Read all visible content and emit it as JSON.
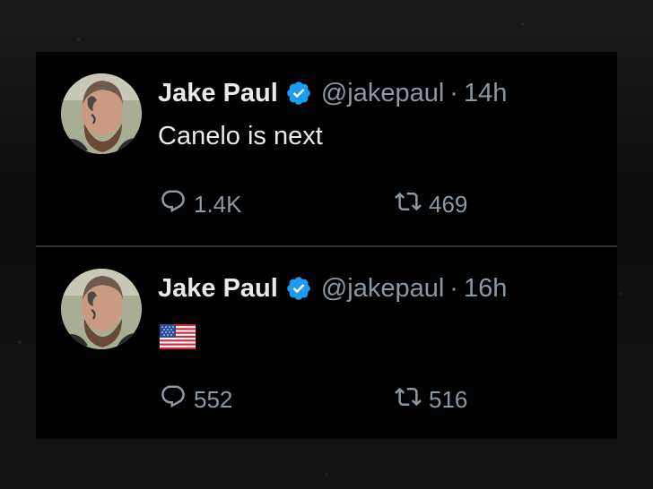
{
  "tweets": [
    {
      "author": "Jake Paul",
      "handle": "@jakepaul",
      "separator": "·",
      "time": "14h",
      "text": "Canelo is next",
      "replies": "1.4K",
      "retweets": "469"
    },
    {
      "author": "Jake Paul",
      "handle": "@jakepaul",
      "separator": "·",
      "time": "16h",
      "text_icon": "us-flag-emoji",
      "replies": "552",
      "retweets": "516"
    }
  ],
  "colors": {
    "background": "#000000",
    "primary_text": "#e7e9ea",
    "secondary_text": "#8b98a5",
    "verified": "#1d9bf0",
    "divider": "#2f3336"
  },
  "icons": {
    "verified": "verified-badge-icon",
    "reply": "reply-icon",
    "retweet": "retweet-icon"
  }
}
